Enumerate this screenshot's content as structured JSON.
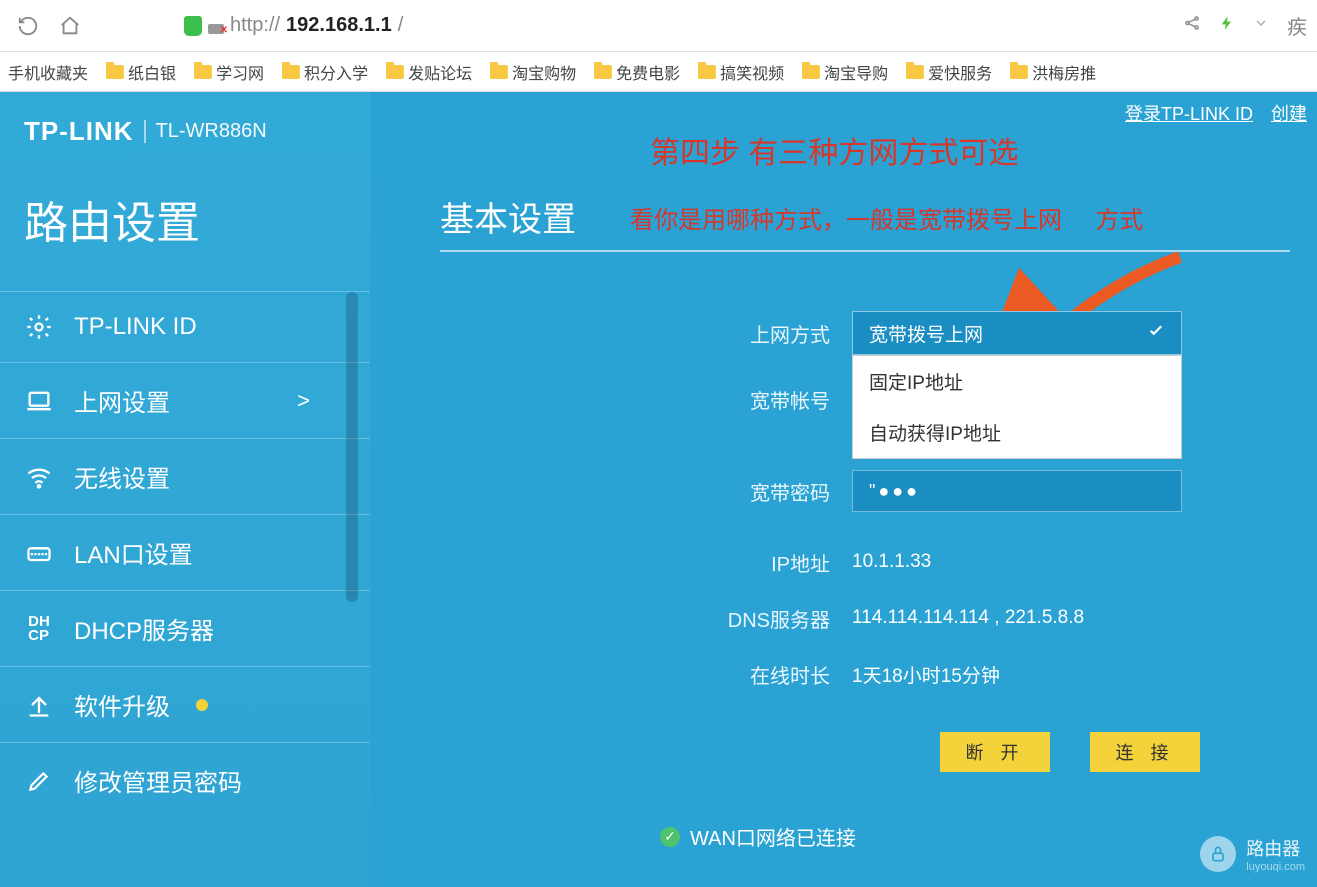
{
  "browser": {
    "url_proto": "http://",
    "url_host": "192.168.1.1",
    "url_path": "/",
    "right_text": "疾"
  },
  "bookmarks": {
    "label0": "手机收藏夹",
    "items": [
      "纸白银",
      "学习网",
      "积分入学",
      "发贴论坛",
      "淘宝购物",
      "免费电影",
      "搞笑视频",
      "淘宝导购",
      "爱快服务",
      "洪梅房推"
    ]
  },
  "header": {
    "brand": "TP-LINK",
    "model": "TL-WR886N",
    "login_link": "登录TP-LINK ID",
    "create_link": "创建"
  },
  "sidebar": {
    "title": "路由设置",
    "items": [
      {
        "label": "TP-LINK ID"
      },
      {
        "label": "上网设置",
        "active": true
      },
      {
        "label": "无线设置"
      },
      {
        "label": "LAN口设置"
      },
      {
        "label": "DHCP服务器"
      },
      {
        "label": "软件升级",
        "dot": true
      },
      {
        "label": "修改管理员密码"
      }
    ],
    "chevron": ">"
  },
  "annot": {
    "step": "第四步  有三种方网方式可选",
    "hint_a": "看你是用哪种方式，一般是宽带拨号上网",
    "hint_b": "方式"
  },
  "main": {
    "section_title": "基本设置",
    "labels": {
      "mode": "上网方式",
      "account": "宽带帐号",
      "password": "宽带密码",
      "ip": "IP地址",
      "dns": "DNS服务器",
      "uptime": "在线时长"
    },
    "dropdown": {
      "selected": "宽带拨号上网",
      "options": [
        "固定IP地址",
        "自动获得IP地址"
      ]
    },
    "pwd_dots": "●●●",
    "values": {
      "ip": "10.1.1.33",
      "dns": "114.114.114.114 , 221.5.8.8",
      "uptime": "1天18小时15分钟"
    },
    "buttons": {
      "disconnect": "断 开",
      "connect": "连 接"
    },
    "status": "WAN口网络已连接"
  },
  "watermark": {
    "t1": "路由器",
    "t2": "luyouqi.com"
  }
}
